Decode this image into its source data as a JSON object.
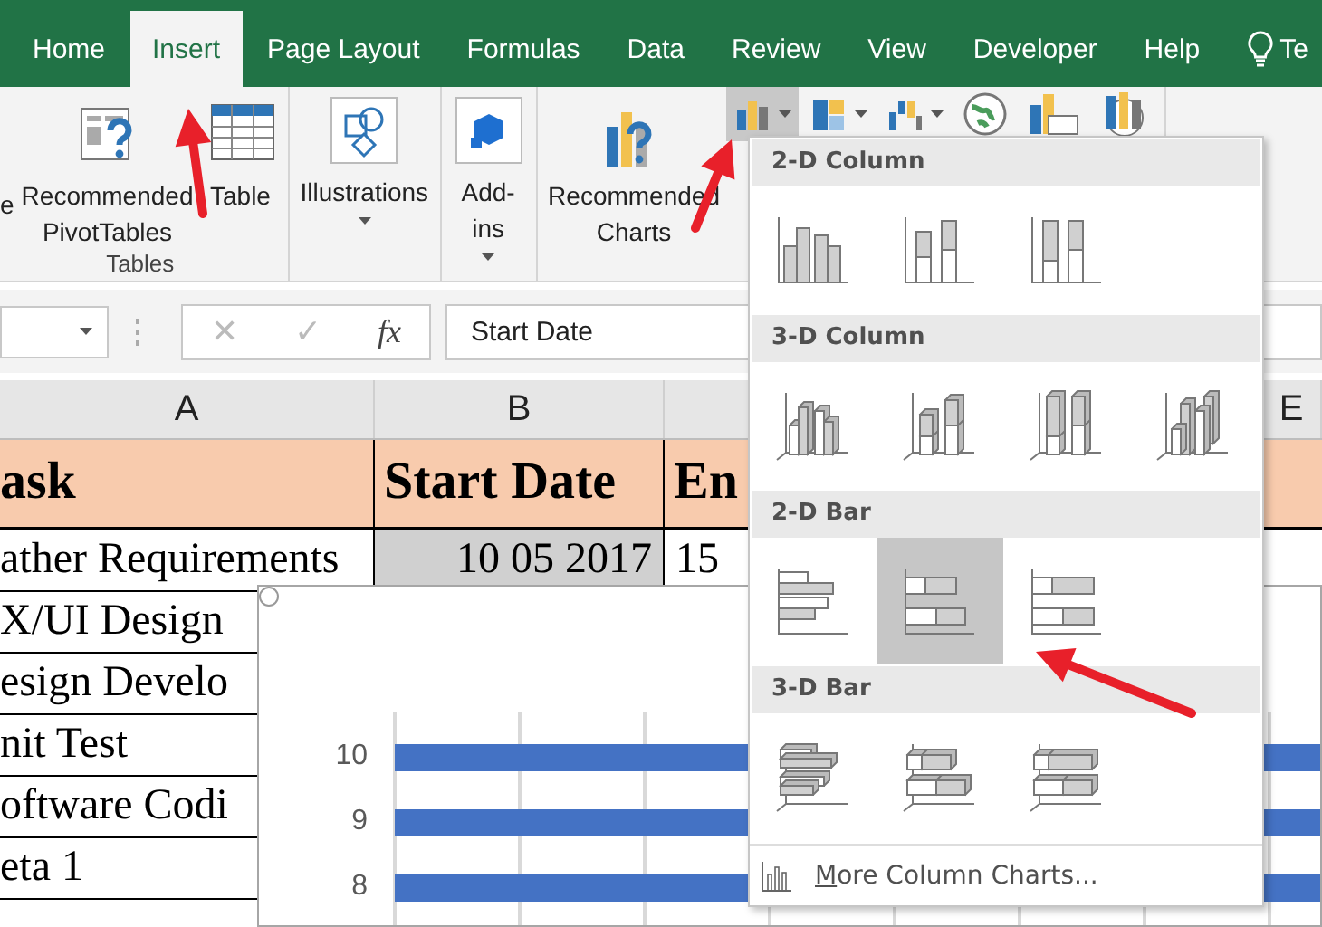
{
  "tabs": [
    {
      "label": "Home",
      "selected": false
    },
    {
      "label": "Insert",
      "selected": true
    },
    {
      "label": "Page Layout",
      "selected": false
    },
    {
      "label": "Formulas",
      "selected": false
    },
    {
      "label": "Data",
      "selected": false
    },
    {
      "label": "Review",
      "selected": false
    },
    {
      "label": "View",
      "selected": false
    },
    {
      "label": "Developer",
      "selected": false
    },
    {
      "label": "Help",
      "selected": false
    },
    {
      "label": "Te",
      "selected": false,
      "kind": "tell"
    }
  ],
  "ribbon": {
    "groups": [
      {
        "label": "Tables",
        "buttons": [
          {
            "kind": "clipped",
            "label": "e"
          },
          {
            "kind": "pivot",
            "label": "Recommended\nPivotTables"
          },
          {
            "kind": "table",
            "label": "Table"
          }
        ]
      },
      {
        "buttons": [
          {
            "kind": "illustrations",
            "label": "Illustrations",
            "caret": true
          }
        ]
      },
      {
        "buttons": [
          {
            "kind": "addins",
            "label": "Add-\nins",
            "caret": true
          }
        ]
      },
      {
        "buttons": [
          {
            "kind": "reccharts",
            "label": "Recommended\nCharts"
          },
          {
            "kind": "column",
            "selected": true
          },
          {
            "kind": "hierarchy",
            "selected": false
          },
          {
            "kind": "waterfall",
            "selected": false
          },
          {
            "kind": "map",
            "selected": false
          },
          {
            "kind": "pivotchart",
            "selected": false
          },
          {
            "kind": "map3d",
            "selected": false
          }
        ]
      }
    ]
  },
  "formula_bar": {
    "cancel": "✕",
    "enter": "✓",
    "function": "fx",
    "value": "Start Date"
  },
  "sheet": {
    "columns": [
      "A",
      "B",
      "E"
    ],
    "header": [
      "ask",
      "Start Date",
      "En"
    ],
    "rows": [
      {
        "task": "ather Requirements",
        "start": "10 05 2017",
        "start_shaded": true,
        "end": "15"
      },
      {
        "task": "X/UI Design"
      },
      {
        "task": "esign Develo"
      },
      {
        "task": "nit Test"
      },
      {
        "task": "oftware Codi"
      },
      {
        "task": "eta 1"
      }
    ]
  },
  "chart": {
    "y_labels": [
      "10",
      "9",
      "8"
    ]
  },
  "chart_menu": {
    "sections": [
      {
        "title": "2-D Column",
        "items": [
          {
            "kind": "col-clustered",
            "selected": false
          },
          {
            "kind": "col-stacked",
            "selected": false
          },
          {
            "kind": "col-100",
            "selected": false
          }
        ]
      },
      {
        "title": "3-D Column",
        "items": [
          {
            "kind": "col3d-clustered",
            "selected": false
          },
          {
            "kind": "col3d-stacked",
            "selected": false
          },
          {
            "kind": "col3d-100",
            "selected": false
          },
          {
            "kind": "col3d",
            "selected": false
          }
        ]
      },
      {
        "title": "2-D Bar",
        "items": [
          {
            "kind": "bar-clustered",
            "selected": false
          },
          {
            "kind": "bar-stacked",
            "selected": true
          },
          {
            "kind": "bar-100",
            "selected": false
          }
        ]
      },
      {
        "title": "3-D Bar",
        "items": [
          {
            "kind": "bar3d-clustered",
            "selected": false
          },
          {
            "kind": "bar3d-stacked",
            "selected": false
          },
          {
            "kind": "bar3d-100",
            "selected": false
          }
        ]
      }
    ],
    "footer": "More Column Charts..."
  }
}
